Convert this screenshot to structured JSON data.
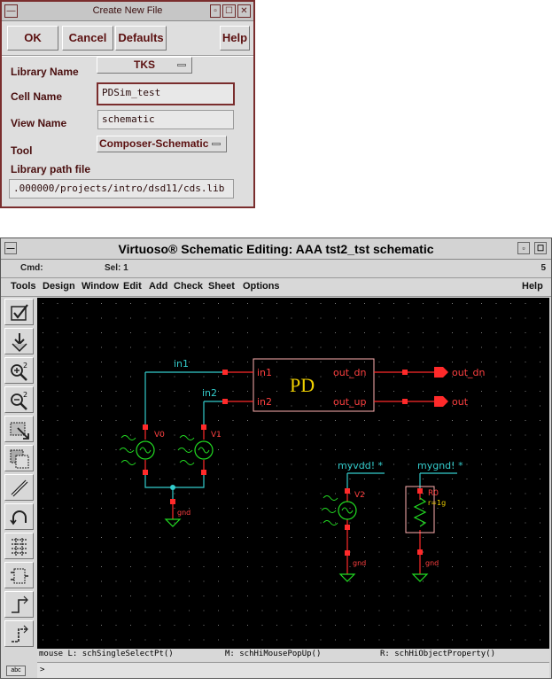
{
  "dialog": {
    "title": "Create New File",
    "buttons": {
      "ok": "OK",
      "cancel": "Cancel",
      "defaults": "Defaults",
      "help": "Help"
    },
    "fields": {
      "library_name_label": "Library Name",
      "library_name_value": "TKS",
      "cell_name_label": "Cell Name",
      "cell_name_value": "PDSim_test",
      "view_name_label": "View Name",
      "view_name_value": "schematic",
      "tool_label": "Tool",
      "tool_value": "Composer-Schematic",
      "library_path_label": "Library path file",
      "library_path_value": ".000000/projects/intro/dsd11/cds.lib"
    }
  },
  "window": {
    "title": "Virtuoso® Schematic Editing: AAA tst2_tst schematic",
    "status": {
      "cmd": "Cmd:",
      "sel": "Sel: 1",
      "count": "5"
    },
    "menu": [
      "Tools",
      "Design",
      "Window",
      "Edit",
      "Add",
      "Check",
      "Sheet",
      "Options"
    ],
    "menu_help": "Help",
    "toolbar_icons": [
      "check-icon",
      "descend-icon",
      "zoom-in-icon",
      "zoom-out-icon",
      "stretch-icon",
      "copy-icon",
      "wire-icon",
      "undo-icon",
      "property-icon",
      "instance-icon",
      "pin-icon",
      "label-icon"
    ],
    "mouse_bindings": {
      "left": "mouse L: schSingleSelectPt()",
      "middle": "M: schHiMousePopUp()",
      "right": "R: schHiObjectProperty()"
    },
    "command_prompt": ">",
    "abc": "abc",
    "schematic": {
      "block_name": "PD",
      "block_pins": {
        "in1": "in1",
        "in2": "in2",
        "out_dn": "out_dn",
        "out_up": "out_up"
      },
      "net_labels": {
        "in1": "in1",
        "in2": "in2",
        "myvdd": "myvdd! *",
        "mygnd": "mygnd! *"
      },
      "output_pins": {
        "out_dn": "out_dn",
        "out": "out"
      },
      "sources": {
        "v0": "V0",
        "v1": "V1",
        "v2": "V2"
      },
      "resistor": {
        "name": "R0",
        "value": "r=1g"
      },
      "gnd_labels": [
        "gnd",
        "gnd",
        "gnd"
      ],
      "colors": {
        "wire": "#33cccc",
        "pin": "#ff2a2a",
        "device": "#ffb0b0",
        "label": "#ff4040",
        "block": "#f0d000",
        "source": "#22dd22",
        "grid": "#7a7a7a"
      }
    }
  }
}
